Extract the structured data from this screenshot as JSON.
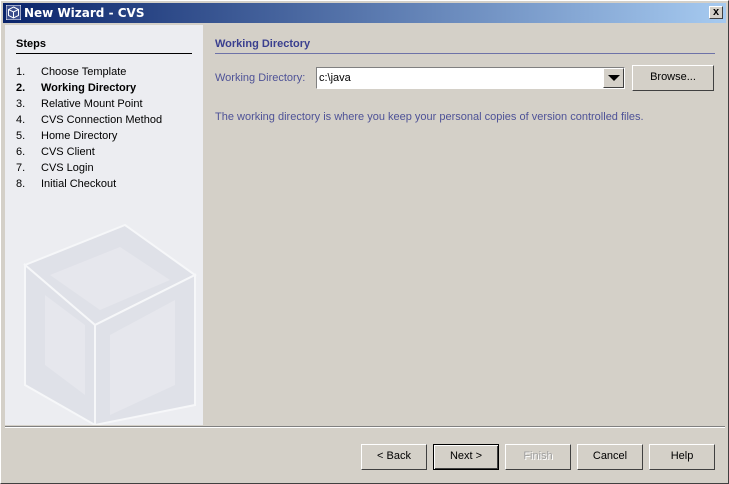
{
  "window": {
    "title": "New Wizard - CVS",
    "close_label": "x"
  },
  "steps": {
    "title": "Steps",
    "items": [
      {
        "num": "1.",
        "label": "Choose Template"
      },
      {
        "num": "2.",
        "label": "Working Directory",
        "active": true
      },
      {
        "num": "3.",
        "label": "Relative Mount Point"
      },
      {
        "num": "4.",
        "label": "CVS Connection Method"
      },
      {
        "num": "5.",
        "label": "Home Directory"
      },
      {
        "num": "6.",
        "label": "CVS Client"
      },
      {
        "num": "7.",
        "label": "CVS Login"
      },
      {
        "num": "8.",
        "label": "Initial Checkout"
      }
    ]
  },
  "main": {
    "section_title": "Working Directory",
    "field_label": "Working Directory:",
    "field_value": "c:\\java",
    "browse_label": "Browse...",
    "info_text": "The working directory is where you keep your personal copies of version controlled files."
  },
  "buttons": {
    "back": "< Back",
    "next": "Next >",
    "finish": "Finish",
    "cancel": "Cancel",
    "help": "Help"
  },
  "colors": {
    "title_gradient_start": "#0a246a",
    "title_gradient_end": "#a6caf0",
    "label_blue": "#4e5297"
  }
}
